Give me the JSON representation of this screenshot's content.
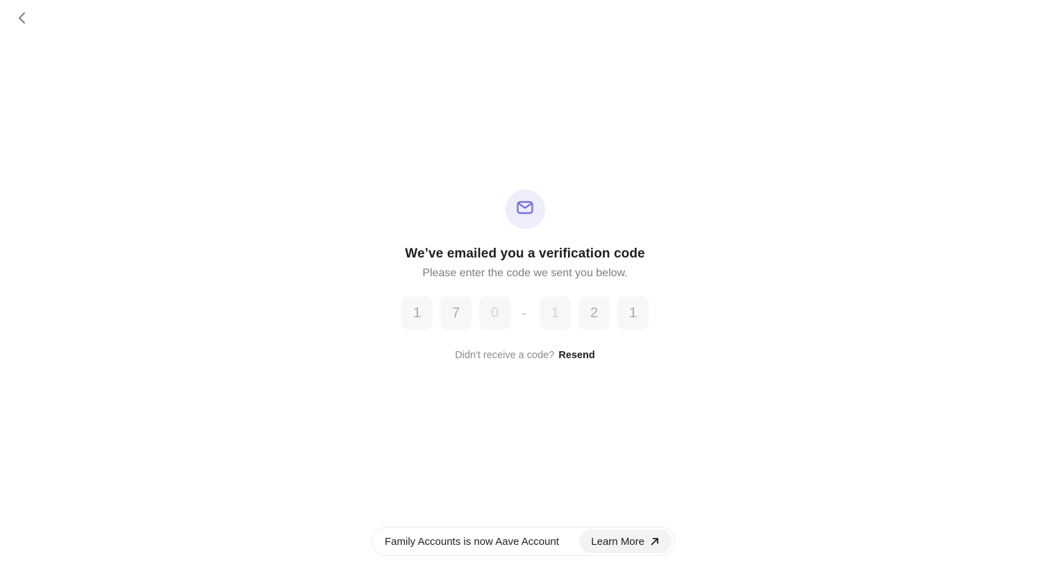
{
  "nav": {
    "back_icon": "chevron-left-icon"
  },
  "hero": {
    "icon": "mail-icon",
    "accent_color": "#7a70e0",
    "badge_color": "#eeedfb",
    "title": "We’ve emailed you a verification code",
    "subtitle": "Please enter the code we sent you below."
  },
  "code": {
    "digits": [
      "1",
      "7",
      "0",
      "1",
      "2",
      "1"
    ],
    "separator": "-"
  },
  "resend": {
    "prompt": "Didn't receive a code?",
    "link_label": "Resend"
  },
  "banner": {
    "text": "Family Accounts is now Aave Account",
    "button_label": "Learn More",
    "button_icon": "arrow-up-right-icon"
  }
}
